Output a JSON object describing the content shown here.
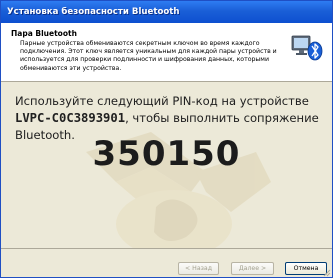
{
  "window": {
    "title": "Установка безопасности Bluetooth"
  },
  "header": {
    "title": "Пара Bluetooth",
    "description": "Парные устройства обмениваются секретным ключом во время каждого подключения. Этот ключ является уникальным для каждой пары устройств и используется для проверки подлинности и шифрования данных, которыми обмениваются эти устройства.",
    "icon": "bluetooth-computer-icon"
  },
  "body": {
    "instruction_before": "Используйте следующий PIN-код на устройстве ",
    "device_name": "LVPC-C0C3893901",
    "instruction_after": ", чтобы выполнить сопряжение Bluetooth.",
    "pin": "350150",
    "watermark_icon": "handshake-watermark-icon"
  },
  "buttons": {
    "back": "< Назад",
    "next": "Далее >",
    "cancel": "Отмена"
  },
  "colors": {
    "titlebar": "#0d4fd0",
    "body_bg": "#ece9d8",
    "header_bg": "#ffffff"
  }
}
